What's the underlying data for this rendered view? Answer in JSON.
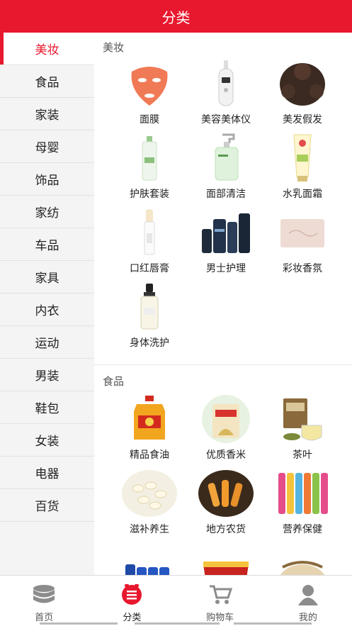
{
  "header": {
    "title": "分类"
  },
  "sidebar": {
    "items": [
      {
        "label": "美妆"
      },
      {
        "label": "食品"
      },
      {
        "label": "家装"
      },
      {
        "label": "母婴"
      },
      {
        "label": "饰品"
      },
      {
        "label": "家纺"
      },
      {
        "label": "车品"
      },
      {
        "label": "家具"
      },
      {
        "label": "内衣"
      },
      {
        "label": "运动"
      },
      {
        "label": "男装"
      },
      {
        "label": "鞋包"
      },
      {
        "label": "女装"
      },
      {
        "label": "电器"
      },
      {
        "label": "百货"
      }
    ],
    "active_index": 0
  },
  "sections": [
    {
      "title": "美妆",
      "items": [
        {
          "label": "面膜",
          "icon": "face-mask-icon"
        },
        {
          "label": "美容美体仪",
          "icon": "beauty-device-icon"
        },
        {
          "label": "美发假发",
          "icon": "wig-icon"
        },
        {
          "label": "护肤套装",
          "icon": "skincare-set-icon"
        },
        {
          "label": "面部清洁",
          "icon": "face-cleanser-icon"
        },
        {
          "label": "水乳面霜",
          "icon": "face-cream-icon"
        },
        {
          "label": "口红唇膏",
          "icon": "lipstick-icon"
        },
        {
          "label": "男士护理",
          "icon": "mens-care-icon"
        },
        {
          "label": "彩妆香氛",
          "icon": "makeup-icon"
        },
        {
          "label": "身体洗护",
          "icon": "body-wash-icon"
        }
      ]
    },
    {
      "title": "食品",
      "items": [
        {
          "label": "精品食油",
          "icon": "cooking-oil-icon"
        },
        {
          "label": "优质香米",
          "icon": "rice-icon"
        },
        {
          "label": "茶叶",
          "icon": "tea-icon"
        },
        {
          "label": "滋补养生",
          "icon": "nuts-icon"
        },
        {
          "label": "地方农货",
          "icon": "local-produce-icon"
        },
        {
          "label": "营养保健",
          "icon": "supplement-icon"
        },
        {
          "label": "",
          "icon": "drinks-icon"
        },
        {
          "label": "",
          "icon": "instant-noodles-icon"
        },
        {
          "label": "",
          "icon": "grains-icon"
        }
      ]
    }
  ],
  "tabbar": {
    "tabs": [
      {
        "label": "首页",
        "icon": "home-stack-icon"
      },
      {
        "label": "分类",
        "icon": "category-icon"
      },
      {
        "label": "购物车",
        "icon": "cart-icon"
      },
      {
        "label": "我的",
        "icon": "user-icon"
      }
    ],
    "active_index": 1
  },
  "colors": {
    "accent": "#e8182e"
  }
}
